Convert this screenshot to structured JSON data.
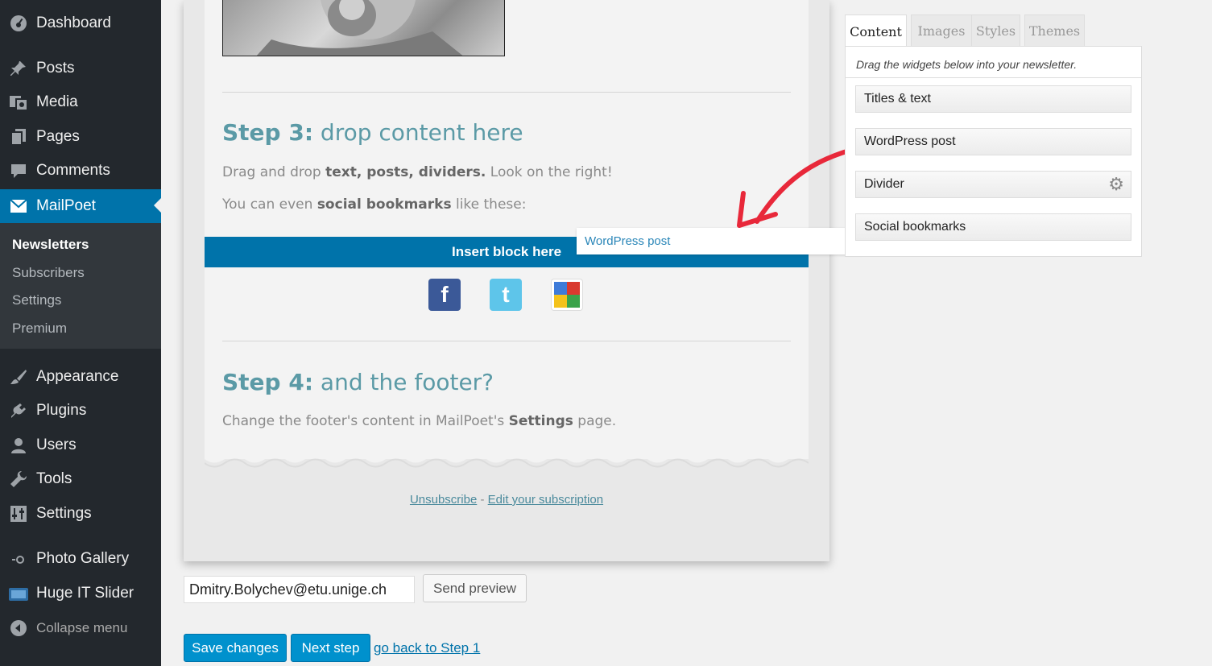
{
  "sidebar": {
    "items": [
      {
        "label": "Dashboard",
        "icon": "dashboard-icon"
      },
      {
        "label": "Posts",
        "icon": "pin-icon"
      },
      {
        "label": "Media",
        "icon": "media-icon"
      },
      {
        "label": "Pages",
        "icon": "pages-icon"
      },
      {
        "label": "Comments",
        "icon": "comment-icon"
      },
      {
        "label": "MailPoet",
        "icon": "envelope-icon"
      },
      {
        "label": "Appearance",
        "icon": "brush-icon"
      },
      {
        "label": "Plugins",
        "icon": "plug-icon"
      },
      {
        "label": "Users",
        "icon": "user-icon"
      },
      {
        "label": "Tools",
        "icon": "wrench-icon"
      },
      {
        "label": "Settings",
        "icon": "settings-icon"
      },
      {
        "label": "Photo Gallery",
        "icon": "gallery-icon"
      },
      {
        "label": "Huge IT Slider",
        "icon": "slider-icon"
      }
    ],
    "submenu": [
      "Newsletters",
      "Subscribers",
      "Settings",
      "Premium"
    ],
    "collapse_label": "Collapse menu"
  },
  "newsletter": {
    "step3_prefix": "Step 3:",
    "step3_rest": " drop content here",
    "step3_line1_a": "Drag and drop ",
    "step3_line1_b": "text, posts, dividers.",
    "step3_line1_c": " Look on the right!",
    "step3_line2_a": "You can even ",
    "step3_line2_b": "social bookmarks",
    "step3_line2_c": " like these:",
    "insert_block": "Insert block here",
    "social_icons": [
      "facebook-icon",
      "twitter-icon",
      "google-icon"
    ],
    "step4_prefix": "Step 4:",
    "step4_rest": " and the footer?",
    "step4_line_a": "Change the footer's content in MailPoet's ",
    "step4_line_b": "Settings",
    "step4_line_c": " page.",
    "unsubscribe": "Unsubscribe",
    "separator": " - ",
    "edit_subscription": "Edit your subscription"
  },
  "drag_ghost": "WordPress post",
  "panel": {
    "tabs": [
      "Content",
      "Images",
      "Styles",
      "Themes"
    ],
    "active_tab": "Content",
    "hint": "Drag the widgets below into your newsletter.",
    "widgets": [
      "Titles & text",
      "WordPress post",
      "Divider",
      "Social bookmarks"
    ]
  },
  "preview": {
    "email": "Dmitry.Bolychev@etu.unige.ch",
    "send_label": "Send preview"
  },
  "actions": {
    "save": "Save changes",
    "next": "Next step",
    "back": "go back to Step 1"
  },
  "colors": {
    "sidebar_bg": "#23282d",
    "active_blue": "#0073aa",
    "arrow_red": "#e8283a",
    "title_teal": "#5b9aa6"
  }
}
